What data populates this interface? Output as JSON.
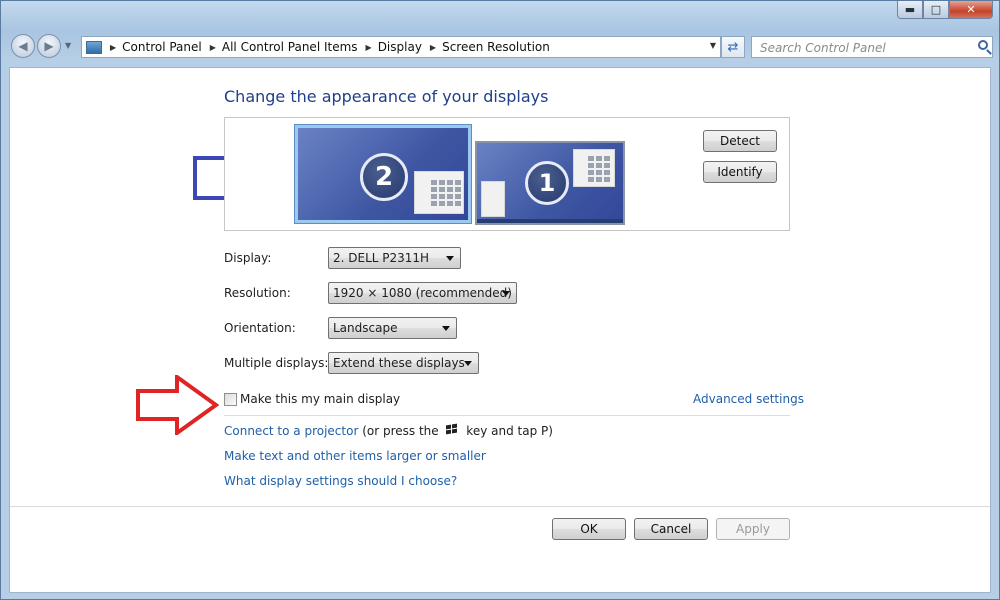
{
  "window": {
    "caption_buttons": [
      "minimize-icon",
      "maximize-icon",
      "close-icon"
    ]
  },
  "nav": {
    "breadcrumbs": [
      "Control Panel",
      "All Control Panel Items",
      "Display",
      "Screen Resolution"
    ],
    "search_placeholder": "Search Control Panel"
  },
  "main": {
    "heading": "Change the appearance of your displays",
    "detect_label": "Detect",
    "identify_label": "Identify",
    "monitor_2_number": "2",
    "monitor_1_number": "1",
    "display_label": "Display:",
    "display_value": "2. DELL P2311H",
    "resolution_label": "Resolution:",
    "resolution_value": "1920 × 1080 (recommended)",
    "orientation_label": "Orientation:",
    "orientation_value": "Landscape",
    "multiple_label": "Multiple displays:",
    "multiple_value": "Extend these displays",
    "main_display_checkbox": "Make this my main display",
    "main_display_checked": false,
    "advanced_link": "Advanced settings",
    "projector_link": "Connect to a projector",
    "projector_hint_pre": " (or press the ",
    "projector_hint_post": " key and tap P)",
    "text_size_link": "Make text and other items larger or smaller",
    "help_link": "What display settings should I choose?",
    "ok_label": "OK",
    "cancel_label": "Cancel",
    "apply_label": "Apply"
  },
  "annotations": {
    "blue_arrow_color": "#3b47b5",
    "red_arrow_color": "#e02424"
  }
}
